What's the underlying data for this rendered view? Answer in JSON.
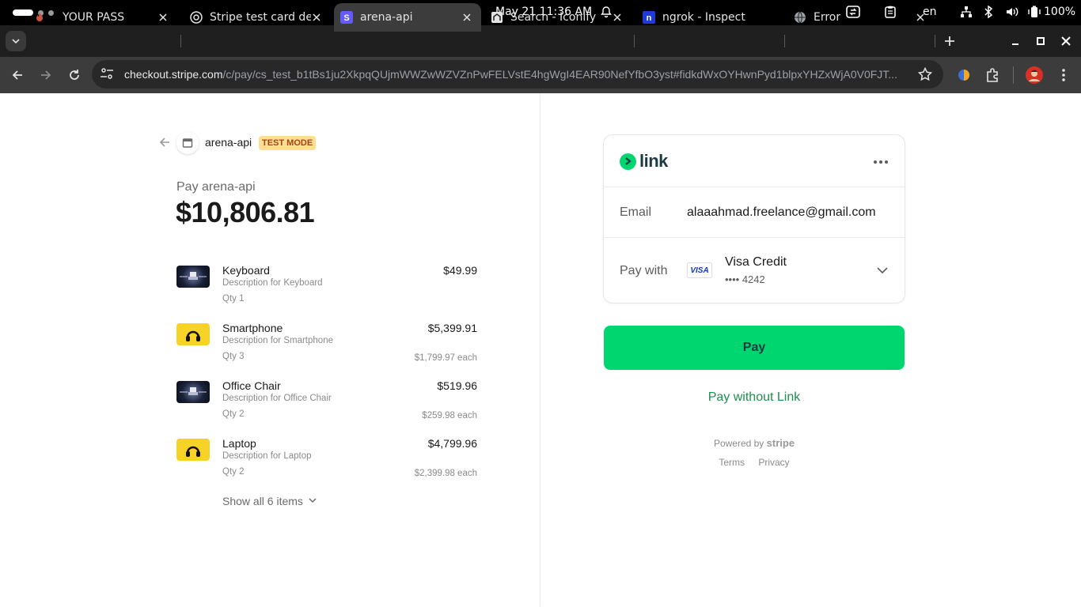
{
  "os": {
    "clock": "May 21  11:36 AM",
    "lang": "en",
    "battery": "100%"
  },
  "tabs": [
    {
      "title": "YOUR PASS",
      "icon": "flame-favicon"
    },
    {
      "title": "Stripe test card de",
      "icon": "stripe-favicon"
    },
    {
      "title": "arena-api",
      "icon": "stripe-s-favicon",
      "active": true
    },
    {
      "title": "Search - Iconify",
      "icon": "iconify-favicon"
    },
    {
      "title": "ngrok - Inspect",
      "icon": "ngrok-favicon"
    },
    {
      "title": "Error",
      "icon": "globe-favicon"
    }
  ],
  "address": {
    "host": "checkout.stripe.com",
    "path": "/c/pay/cs_test_b1tBs1ju2XkpqQUjmWWZwWZVZnPwFELVstE4hgWgI4EAR90NefYfbO3yst#fidkdWxOYHwnPyd1blpxYHZxWjA0V0FJT..."
  },
  "merchant": {
    "name": "arena-api",
    "badge": "TEST MODE",
    "pay_label": "Pay arena-api",
    "total": "$10,806.81"
  },
  "items": [
    {
      "name": "Keyboard",
      "desc": "Description for Keyboard",
      "qty": "Qty 1",
      "price": "$49.99",
      "each": "",
      "thumb": "dark"
    },
    {
      "name": "Smartphone",
      "desc": "Description for Smartphone",
      "qty": "Qty 3",
      "price": "$5,399.91",
      "each": "$1,799.97 each",
      "thumb": "yellow"
    },
    {
      "name": "Office Chair",
      "desc": "Description for Office Chair",
      "qty": "Qty 2",
      "price": "$519.96",
      "each": "$259.98 each",
      "thumb": "dark"
    },
    {
      "name": "Laptop",
      "desc": "Description for Laptop",
      "qty": "Qty 2",
      "price": "$4,799.96",
      "each": "$2,399.98 each",
      "thumb": "yellow"
    }
  ],
  "show_all": "Show all 6 items",
  "link": {
    "wordmark": "link",
    "email_label": "Email",
    "email": "alaaahmad.freelance@gmail.com",
    "pay_with_label": "Pay with",
    "card_badge": "VISA",
    "card_brand": "Visa Credit",
    "card_last4": "•••• 4242",
    "pay_button": "Pay",
    "pay_without": "Pay without Link",
    "powered_by": "Powered by",
    "powered_brand": "stripe",
    "terms": "Terms",
    "privacy": "Privacy"
  },
  "colors": {
    "link_green": "#00d66f",
    "link_text": "#1d3944",
    "test_badge_bg": "#ffde92",
    "test_badge_text": "#a0461b"
  }
}
